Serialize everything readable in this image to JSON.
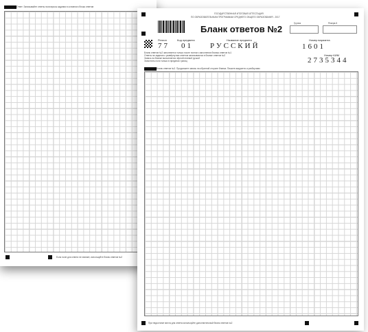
{
  "back_sheet": {
    "section_header": "Ответ: Записывайте ответы на вопросы задания в основного блока ответов",
    "footer_note": "Если поле для ответа не хватает, используйте бланк ответов №2"
  },
  "front_sheet": {
    "header_line1": "ГОСУДАРСТВЕННАЯ ИТОГОВАЯ АТТЕСТАЦИЯ",
    "header_line2": "ПО ОБРАЗОВАТЕЛЬНЫМ ПРОГРАММАМ СРЕДНЕГО ОБЩЕГО ОБРАЗОВАНИЯ - 2017",
    "title": "Бланк ответов №2",
    "label_group": "Группа",
    "label_reserve": "Резерв-5",
    "label_region": "Регион",
    "label_subject_code": "Код предмета",
    "label_subject_name": "Название предмета",
    "label_variant": "Номер варианта",
    "region_value": "77",
    "subject_code_value": "01",
    "subject_name_value": "РУССКИЙ",
    "variant_value": "1601",
    "label_kim": "Номер КИМ",
    "kim_value": "2735344",
    "instruction_line1": "Бланк ответов №2 заполняется только после полного заполнения бланка ответов №1",
    "instruction_line2": "Ответы на задания с развёрнутым ответом записываются в бланке ответов №2",
    "instruction_line3": "Запись на бланке выполняется чёрной гелевой ручкой",
    "instruction_line4": "Заполнять поля только в пределах границ",
    "section_header": "Бланк ответов №2. Продолжите запись на обратной стороне бланка. Пишите аккуратно и разборчиво",
    "footer_note": "При недостатке места для ответа используйте дополнительный бланк ответов №2"
  }
}
